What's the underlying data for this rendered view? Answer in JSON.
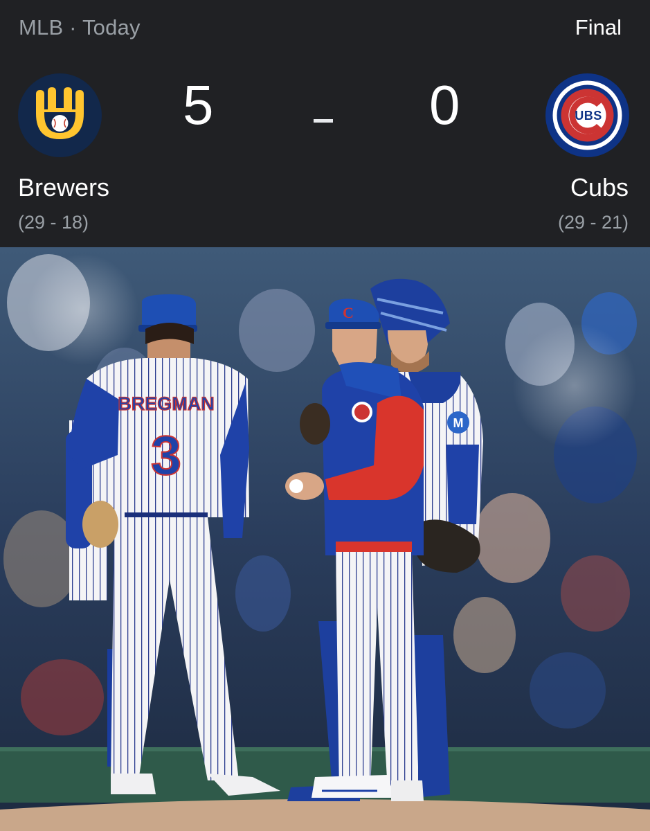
{
  "header": {
    "league": "MLB",
    "separator": "·",
    "date": "Today",
    "status": "Final"
  },
  "home_team": {
    "name": "Brewers",
    "score": "5",
    "record": "(29 - 18)",
    "logo": "brewers-ball-in-glove-logo",
    "color": "#12284b",
    "accent": "#ffc52f"
  },
  "away_team": {
    "name": "Cubs",
    "score": "0",
    "record": "(29 - 21)",
    "logo": "cubs-bullseye-logo",
    "color": "#0e3386",
    "accent": "#cc3433"
  },
  "photo": {
    "description_icon": "baseball-mound-visit-photo",
    "jersey_name": "BREGMAN",
    "jersey_number": "3",
    "cap_letter": "C",
    "sleeve_patch": "M"
  }
}
